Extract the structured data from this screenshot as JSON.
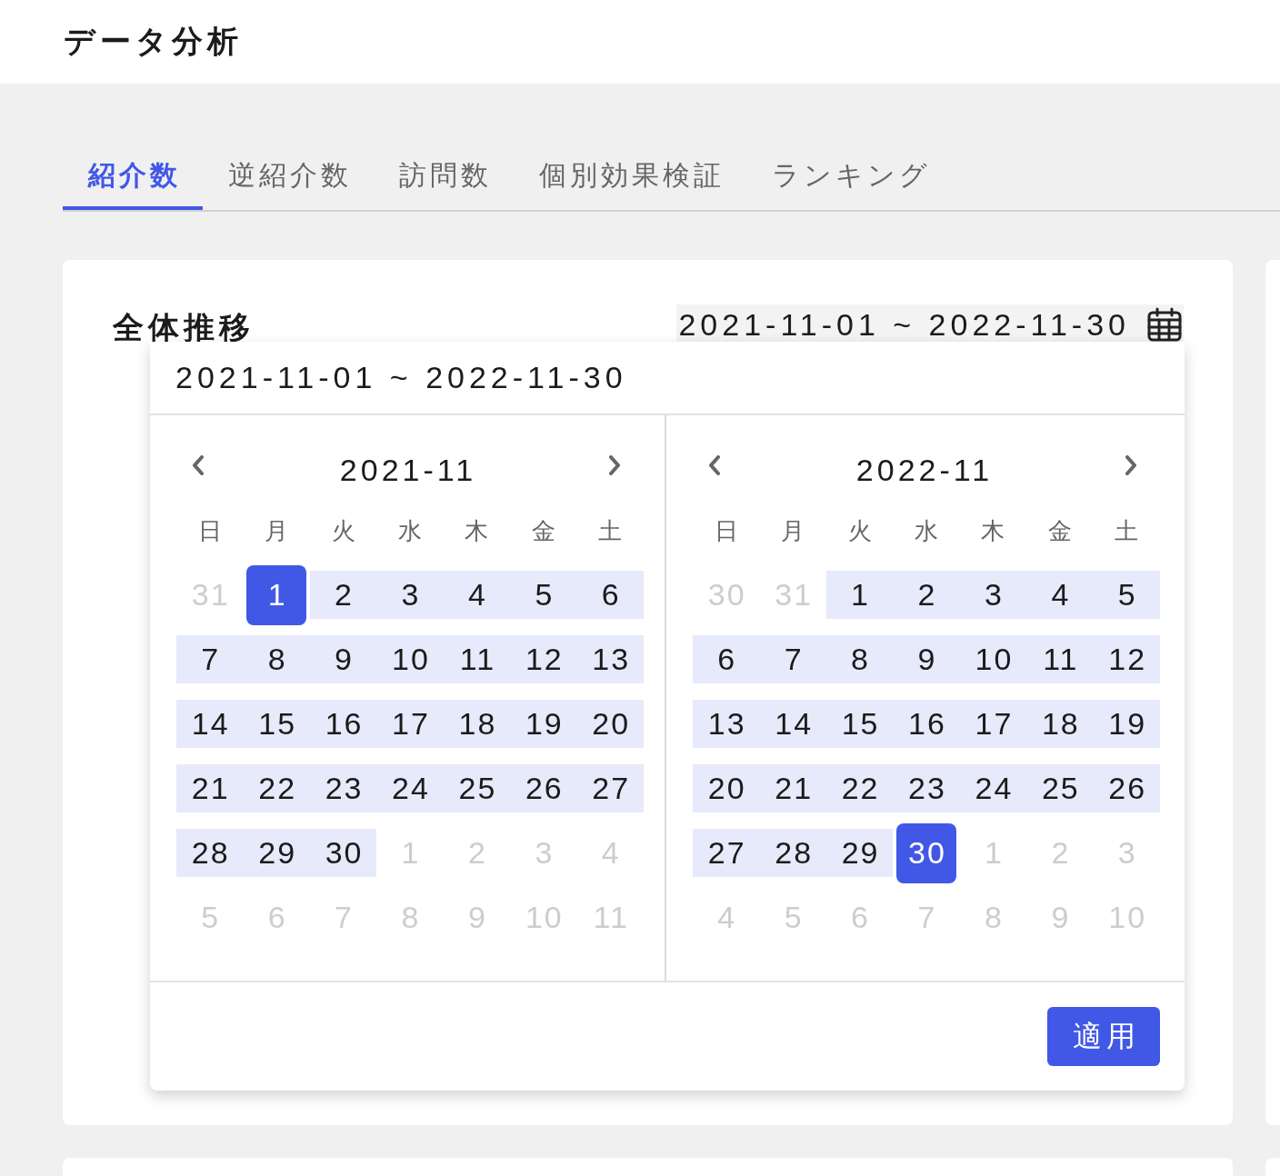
{
  "header": {
    "title": "データ分析"
  },
  "tabs": [
    {
      "label": "紹介数",
      "selected": true
    },
    {
      "label": "逆紹介数",
      "selected": false
    },
    {
      "label": "訪問数",
      "selected": false
    },
    {
      "label": "個別効果検証",
      "selected": false
    },
    {
      "label": "ランキング",
      "selected": false
    }
  ],
  "card": {
    "title": "全体推移",
    "date_range": "2021-11-01 ~ 2022-11-30"
  },
  "picker": {
    "input": "2021-11-01 ~ 2022-11-30",
    "calendars": [
      {
        "month": "2021-11",
        "weekdays": [
          "日",
          "月",
          "火",
          "水",
          "木",
          "金",
          "土"
        ],
        "weeks": [
          [
            {
              "day": "31",
              "kind": "outside",
              "selected": false
            },
            {
              "day": "1",
              "kind": "range",
              "selected": true
            },
            {
              "day": "2",
              "kind": "range",
              "selected": false
            },
            {
              "day": "3",
              "kind": "range",
              "selected": false
            },
            {
              "day": "4",
              "kind": "range",
              "selected": false
            },
            {
              "day": "5",
              "kind": "range",
              "selected": false
            },
            {
              "day": "6",
              "kind": "range",
              "selected": false
            }
          ],
          [
            {
              "day": "7",
              "kind": "range",
              "selected": false
            },
            {
              "day": "8",
              "kind": "range",
              "selected": false
            },
            {
              "day": "9",
              "kind": "range",
              "selected": false
            },
            {
              "day": "10",
              "kind": "range",
              "selected": false
            },
            {
              "day": "11",
              "kind": "range",
              "selected": false
            },
            {
              "day": "12",
              "kind": "range",
              "selected": false
            },
            {
              "day": "13",
              "kind": "range",
              "selected": false
            }
          ],
          [
            {
              "day": "14",
              "kind": "range",
              "selected": false
            },
            {
              "day": "15",
              "kind": "range",
              "selected": false
            },
            {
              "day": "16",
              "kind": "range",
              "selected": false
            },
            {
              "day": "17",
              "kind": "range",
              "selected": false
            },
            {
              "day": "18",
              "kind": "range",
              "selected": false
            },
            {
              "day": "19",
              "kind": "range",
              "selected": false
            },
            {
              "day": "20",
              "kind": "range",
              "selected": false
            }
          ],
          [
            {
              "day": "21",
              "kind": "range",
              "selected": false
            },
            {
              "day": "22",
              "kind": "range",
              "selected": false
            },
            {
              "day": "23",
              "kind": "range",
              "selected": false
            },
            {
              "day": "24",
              "kind": "range",
              "selected": false
            },
            {
              "day": "25",
              "kind": "range",
              "selected": false
            },
            {
              "day": "26",
              "kind": "range",
              "selected": false
            },
            {
              "day": "27",
              "kind": "range",
              "selected": false
            }
          ],
          [
            {
              "day": "28",
              "kind": "range",
              "selected": false
            },
            {
              "day": "29",
              "kind": "range",
              "selected": false
            },
            {
              "day": "30",
              "kind": "range",
              "selected": false
            },
            {
              "day": "1",
              "kind": "outside",
              "selected": false
            },
            {
              "day": "2",
              "kind": "outside",
              "selected": false
            },
            {
              "day": "3",
              "kind": "outside",
              "selected": false
            },
            {
              "day": "4",
              "kind": "outside",
              "selected": false
            }
          ],
          [
            {
              "day": "5",
              "kind": "outside",
              "selected": false
            },
            {
              "day": "6",
              "kind": "outside",
              "selected": false
            },
            {
              "day": "7",
              "kind": "outside",
              "selected": false
            },
            {
              "day": "8",
              "kind": "outside",
              "selected": false
            },
            {
              "day": "9",
              "kind": "outside",
              "selected": false
            },
            {
              "day": "10",
              "kind": "outside",
              "selected": false
            },
            {
              "day": "11",
              "kind": "outside",
              "selected": false
            }
          ]
        ]
      },
      {
        "month": "2022-11",
        "weekdays": [
          "日",
          "月",
          "火",
          "水",
          "木",
          "金",
          "土"
        ],
        "weeks": [
          [
            {
              "day": "30",
              "kind": "outside",
              "selected": false
            },
            {
              "day": "31",
              "kind": "outside",
              "selected": false
            },
            {
              "day": "1",
              "kind": "range",
              "selected": false
            },
            {
              "day": "2",
              "kind": "range",
              "selected": false
            },
            {
              "day": "3",
              "kind": "range",
              "selected": false
            },
            {
              "day": "4",
              "kind": "range",
              "selected": false
            },
            {
              "day": "5",
              "kind": "range",
              "selected": false
            }
          ],
          [
            {
              "day": "6",
              "kind": "range",
              "selected": false
            },
            {
              "day": "7",
              "kind": "range",
              "selected": false
            },
            {
              "day": "8",
              "kind": "range",
              "selected": false
            },
            {
              "day": "9",
              "kind": "range",
              "selected": false
            },
            {
              "day": "10",
              "kind": "range",
              "selected": false
            },
            {
              "day": "11",
              "kind": "range",
              "selected": false
            },
            {
              "day": "12",
              "kind": "range",
              "selected": false
            }
          ],
          [
            {
              "day": "13",
              "kind": "range",
              "selected": false
            },
            {
              "day": "14",
              "kind": "range",
              "selected": false
            },
            {
              "day": "15",
              "kind": "range",
              "selected": false
            },
            {
              "day": "16",
              "kind": "range",
              "selected": false
            },
            {
              "day": "17",
              "kind": "range",
              "selected": false
            },
            {
              "day": "18",
              "kind": "range",
              "selected": false
            },
            {
              "day": "19",
              "kind": "range",
              "selected": false
            }
          ],
          [
            {
              "day": "20",
              "kind": "range",
              "selected": false
            },
            {
              "day": "21",
              "kind": "range",
              "selected": false
            },
            {
              "day": "22",
              "kind": "range",
              "selected": false
            },
            {
              "day": "23",
              "kind": "range",
              "selected": false
            },
            {
              "day": "24",
              "kind": "range",
              "selected": false
            },
            {
              "day": "25",
              "kind": "range",
              "selected": false
            },
            {
              "day": "26",
              "kind": "range",
              "selected": false
            }
          ],
          [
            {
              "day": "27",
              "kind": "range",
              "selected": false
            },
            {
              "day": "28",
              "kind": "range",
              "selected": false
            },
            {
              "day": "29",
              "kind": "range",
              "selected": false
            },
            {
              "day": "30",
              "kind": "range",
              "selected": true
            },
            {
              "day": "1",
              "kind": "outside",
              "selected": false
            },
            {
              "day": "2",
              "kind": "outside",
              "selected": false
            },
            {
              "day": "3",
              "kind": "outside",
              "selected": false
            }
          ],
          [
            {
              "day": "4",
              "kind": "outside",
              "selected": false
            },
            {
              "day": "5",
              "kind": "outside",
              "selected": false
            },
            {
              "day": "6",
              "kind": "outside",
              "selected": false
            },
            {
              "day": "7",
              "kind": "outside",
              "selected": false
            },
            {
              "day": "8",
              "kind": "outside",
              "selected": false
            },
            {
              "day": "9",
              "kind": "outside",
              "selected": false
            },
            {
              "day": "10",
              "kind": "outside",
              "selected": false
            }
          ]
        ]
      }
    ],
    "apply_button": "適用"
  }
}
